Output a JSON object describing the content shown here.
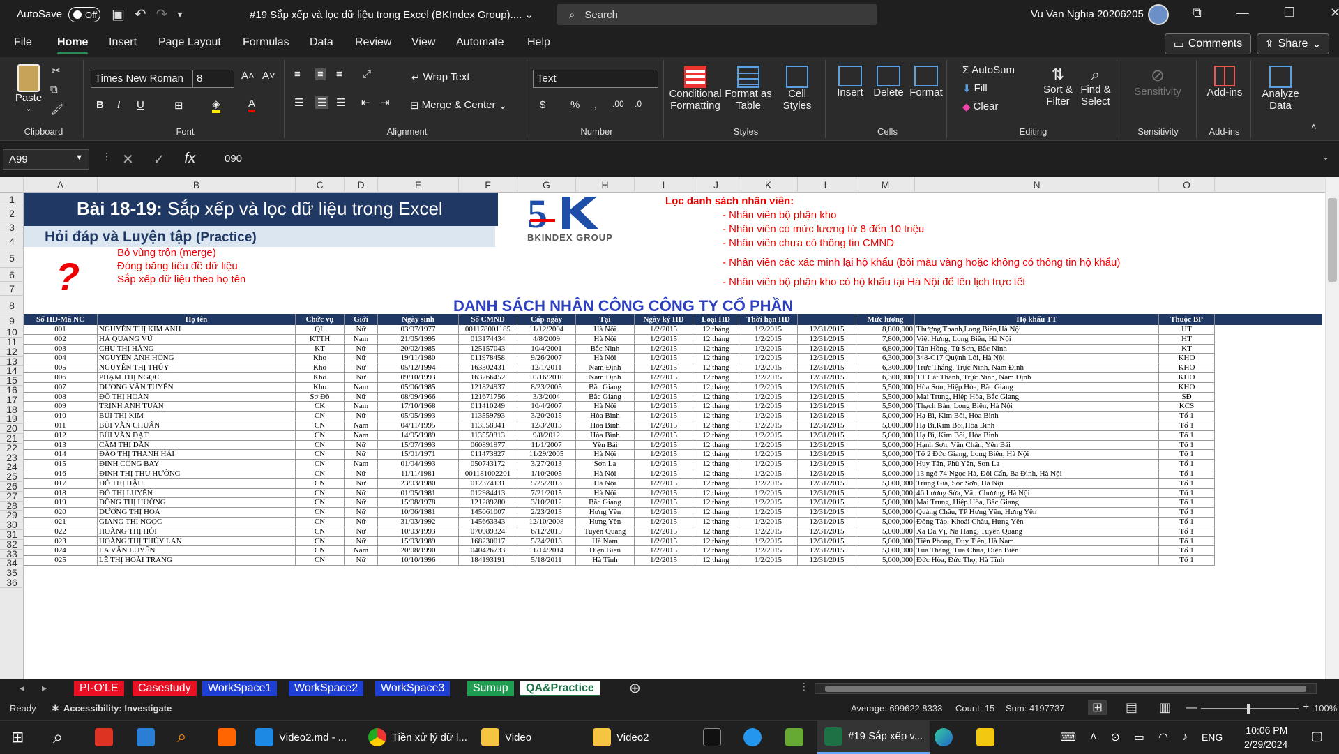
{
  "titlebar": {
    "autosave_label": "AutoSave",
    "autosave_state": "Off",
    "doc_title": "#19 Sắp xếp và lọc dữ liệu trong Excel (BKIndex Group)....",
    "search_placeholder": "Search",
    "user_name": "Vu Van Nghia 20206205"
  },
  "menu": {
    "tabs": [
      "File",
      "Home",
      "Insert",
      "Page Layout",
      "Formulas",
      "Data",
      "Review",
      "View",
      "Automate",
      "Help"
    ],
    "active": "Home",
    "comments": "Comments",
    "share": "Share"
  },
  "ribbon": {
    "clipboard": {
      "paste": "Paste",
      "label": "Clipboard"
    },
    "font": {
      "name": "Times New Roman",
      "size": "8",
      "label": "Font"
    },
    "alignment": {
      "wrap": "Wrap Text",
      "merge": "Merge & Center",
      "label": "Alignment"
    },
    "number": {
      "format": "Text",
      "label": "Number"
    },
    "styles": {
      "cond": "Conditional",
      "cond2": "Formatting",
      "fmt_table": "Format as",
      "fmt_table2": "Table",
      "cell_styles": "Cell",
      "cell_styles2": "Styles",
      "label": "Styles"
    },
    "cells": {
      "insert": "Insert",
      "delete": "Delete",
      "format": "Format",
      "label": "Cells"
    },
    "editing": {
      "autosum": "AutoSum",
      "fill": "Fill",
      "clear": "Clear",
      "sort": "Sort &",
      "sort2": "Filter",
      "find": "Find &",
      "find2": "Select",
      "label": "Editing"
    },
    "sensitivity": {
      "btn": "Sensitivity",
      "label": "Sensitivity"
    },
    "addins": {
      "btn": "Add-ins",
      "label": "Add-ins"
    },
    "analyze": {
      "btn": "Analyze",
      "btn2": "Data"
    }
  },
  "formula_bar": {
    "cell_ref": "A99",
    "value": "090"
  },
  "columns": [
    "A",
    "B",
    "C",
    "D",
    "E",
    "F",
    "G",
    "H",
    "I",
    "J",
    "K",
    "L",
    "M",
    "N",
    "O"
  ],
  "rows": [
    "1",
    "2",
    "3",
    "4",
    "5",
    "6",
    "7",
    "8",
    "9",
    "10",
    "11",
    "12",
    "13",
    "14",
    "15",
    "16",
    "17",
    "18",
    "19",
    "20",
    "21",
    "22",
    "23",
    "24",
    "25",
    "26",
    "27",
    "28",
    "29",
    "30",
    "31",
    "32",
    "33",
    "34",
    "35",
    "36"
  ],
  "content": {
    "banner_title_bold": "Bài 18-19:",
    "banner_title": " Sắp xếp và lọc dữ liệu trong Excel",
    "banner_sub": "Hỏi đáp và Luyện tập",
    "banner_sub2": "(Practice)",
    "logo_text": "BKINDEX GROUP",
    "qmark": "?",
    "tasks": [
      "Bỏ vùng trộn (merge)",
      "Đóng băng tiêu đề dữ liệu",
      "Sắp xếp dữ liệu theo họ tên"
    ],
    "filter_title": "Lọc danh sách nhân viên:",
    "filters": [
      "- Nhân viên bộ phận kho",
      "- Nhân viên có mức lương từ 8 đến 10 triệu",
      "- Nhân viên chưa có thông tin CMND",
      "- Nhân viên các xác minh lại hộ khẩu (bôi màu vàng hoặc không có thông tin hộ khẩu)",
      "- Nhân viên bộ phận kho có hộ khẩu tại Hà Nội để lên lịch trực tết"
    ],
    "list_title": "DANH SÁCH NHÂN CÔNG CÔNG TY CỔ PHẦN"
  },
  "table": {
    "headers": [
      "Số HĐ-Mã NC",
      "Họ tên",
      "Chức vụ",
      "Giới",
      "Ngày sinh",
      "Số CMND",
      "Cấp ngày",
      "Tại",
      "Ngày ký HĐ",
      "Loại HĐ",
      "Thời hạn HĐ",
      "",
      "Mức lương",
      "Hộ khẩu TT",
      "Thuộc BP"
    ],
    "rows": [
      [
        "001",
        "NGUYỄN THỊ KIM ANH",
        "QL",
        "Nữ",
        "03/07/1977",
        "001178001185",
        "11/12/2004",
        "Hà Nội",
        "1/2/2015",
        "12 tháng",
        "1/2/2015",
        "12/31/2015",
        "8,800,000",
        "Thượng Thanh,Long Biên,Hà Nội",
        "HT"
      ],
      [
        "002",
        "HÀ QUANG VŨ",
        "KTTH",
        "Nam",
        "21/05/1995",
        "013174434",
        "4/8/2009",
        "Hà Nội",
        "1/2/2015",
        "12 tháng",
        "1/2/2015",
        "12/31/2015",
        "7,800,000",
        "Việt Hưng, Long Biên, Hà Nội",
        "HT"
      ],
      [
        "003",
        "CHU THỊ HẰNG",
        "KT",
        "Nữ",
        "20/02/1985",
        "125157043",
        "10/4/2001",
        "Bắc Ninh",
        "1/2/2015",
        "12 tháng",
        "1/2/2015",
        "12/31/2015",
        "6,800,000",
        "Tân Hồng, Từ Sơn, Bắc Ninh",
        "KT"
      ],
      [
        "004",
        "NGUYỄN ÁNH HỒNG",
        "Kho",
        "Nữ",
        "19/11/1980",
        "011978458",
        "9/26/2007",
        "Hà Nội",
        "1/2/2015",
        "12 tháng",
        "1/2/2015",
        "12/31/2015",
        "6,300,000",
        "348-C17 Quỳnh Lôi, Hà Nội",
        "KHO"
      ],
      [
        "005",
        "NGUYỄN THỊ THÚY",
        "Kho",
        "Nữ",
        "05/12/1994",
        "163302431",
        "12/1/2011",
        "Nam Định",
        "1/2/2015",
        "12 tháng",
        "1/2/2015",
        "12/31/2015",
        "6,300,000",
        "Trực Thắng, Trực Ninh, Nam Định",
        "KHO"
      ],
      [
        "006",
        "PHẠM THỊ NGỌC",
        "Kho",
        "Nữ",
        "09/10/1993",
        "163266452",
        "10/16/2010",
        "Nam Định",
        "1/2/2015",
        "12 tháng",
        "1/2/2015",
        "12/31/2015",
        "6,300,000",
        "TT Cát Thành, Trực Ninh, Nam Định",
        "KHO"
      ],
      [
        "007",
        "DƯƠNG VĂN TUYẾN",
        "Kho",
        "Nam",
        "05/06/1985",
        "121824937",
        "8/23/2005",
        "Bắc Giang",
        "1/2/2015",
        "12 tháng",
        "1/2/2015",
        "12/31/2015",
        "5,500,000",
        "Hòa Sơn, Hiệp Hòa, Bắc Giang",
        "KHO"
      ],
      [
        "008",
        "ĐỖ THỊ HOÀN",
        "Sơ Đồ",
        "Nữ",
        "08/09/1966",
        "121671756",
        "3/3/2004",
        "Bắc Giang",
        "1/2/2015",
        "12 tháng",
        "1/2/2015",
        "12/31/2015",
        "5,500,000",
        "Mai Trung, Hiệp Hòa, Bắc Giang",
        "SĐ"
      ],
      [
        "009",
        "TRỊNH ANH TUẤN",
        "CK",
        "Nam",
        "17/10/1968",
        "011410249",
        "10/4/2007",
        "Hà Nội",
        "1/2/2015",
        "12 tháng",
        "1/2/2015",
        "12/31/2015",
        "5,500,000",
        "Thạch Bàn, Long Biên, Hà Nội",
        "KCS"
      ],
      [
        "010",
        "BÙI THỊ KIM",
        "CN",
        "Nữ",
        "05/05/1993",
        "113559793",
        "3/20/2015",
        "Hòa Bình",
        "1/2/2015",
        "12 tháng",
        "1/2/2015",
        "12/31/2015",
        "5,000,000",
        "Hạ Bì, Kim Bôi, Hòa Bình",
        "Tổ 1"
      ],
      [
        "011",
        "BÙI VĂN CHUẨN",
        "CN",
        "Nam",
        "04/11/1995",
        "113558941",
        "12/3/2013",
        "Hòa Bình",
        "1/2/2015",
        "12 tháng",
        "1/2/2015",
        "12/31/2015",
        "5,000,000",
        "Hạ Bì,Kim Bôi,Hòa Bình",
        "Tổ 1"
      ],
      [
        "012",
        "BÙI VĂN ĐẠT",
        "CN",
        "Nam",
        "14/05/1989",
        "113559813",
        "9/8/2012",
        "Hòa Bình",
        "1/2/2015",
        "12 tháng",
        "1/2/2015",
        "12/31/2015",
        "5,000,000",
        "Hạ Bì, Kim Bôi, Hòa Bình",
        "Tổ 1"
      ],
      [
        "013",
        "CẦM THỊ DẦN",
        "CN",
        "Nữ",
        "15/07/1993",
        "060891977",
        "11/1/2007",
        "Yên Bái",
        "1/2/2015",
        "12 tháng",
        "1/2/2015",
        "12/31/2015",
        "5,000,000",
        "Hạnh Sơn, Văn Chấn, Yên Bái",
        "Tổ 1"
      ],
      [
        "014",
        "ĐÀO THỊ THANH HẢI",
        "CN",
        "Nữ",
        "15/01/1971",
        "011473827",
        "11/29/2005",
        "Hà Nội",
        "1/2/2015",
        "12 tháng",
        "1/2/2015",
        "12/31/2015",
        "5,000,000",
        "Tổ 2 Đức Giang, Long Biên, Hà Nội",
        "Tổ 1"
      ],
      [
        "015",
        "ĐINH CÔNG BAY",
        "CN",
        "Nam",
        "01/04/1993",
        "050743172",
        "3/27/2013",
        "Sơn La",
        "1/2/2015",
        "12 tháng",
        "1/2/2015",
        "12/31/2015",
        "5,000,000",
        "Huy Tân, Phù Yên, Sơn La",
        "Tổ 1"
      ],
      [
        "016",
        "ĐINH THỊ THU HƯỜNG",
        "CN",
        "Nữ",
        "11/11/1981",
        "001181002201",
        "1/10/2005",
        "Hà Nội",
        "1/2/2015",
        "12 tháng",
        "1/2/2015",
        "12/31/2015",
        "5,000,000",
        "13 ngõ 74 Ngọc Hà, Đội Cấn, Ba Đình, Hà Nội",
        "Tổ 1"
      ],
      [
        "017",
        "ĐỖ THỊ HẬU",
        "CN",
        "Nữ",
        "23/03/1980",
        "012374131",
        "5/25/2013",
        "Hà Nội",
        "1/2/2015",
        "12 tháng",
        "1/2/2015",
        "12/31/2015",
        "5,000,000",
        "Trung Giã, Sóc Sơn, Hà Nội",
        "Tổ 1"
      ],
      [
        "018",
        "ĐỖ THỊ LUYẾN",
        "CN",
        "Nữ",
        "01/05/1981",
        "012984413",
        "7/21/2015",
        "Hà Nội",
        "1/2/2015",
        "12 tháng",
        "1/2/2015",
        "12/31/2015",
        "5,000,000",
        "46 Lương Sửa, Văn Chương, Hà Nội",
        "Tổ 1"
      ],
      [
        "019",
        "ĐỒNG THỊ HƯỜNG",
        "CN",
        "Nữ",
        "15/08/1978",
        "121289280",
        "3/10/2012",
        "Bắc Giang",
        "1/2/2015",
        "12 tháng",
        "1/2/2015",
        "12/31/2015",
        "5,000,000",
        "Mai Trung, Hiệp Hòa, Bắc Giang",
        "Tổ 1"
      ],
      [
        "020",
        "DƯƠNG THỊ HOA",
        "CN",
        "Nữ",
        "10/06/1981",
        "145061007",
        "2/23/2013",
        "Hưng Yên",
        "1/2/2015",
        "12 tháng",
        "1/2/2015",
        "12/31/2015",
        "5,000,000",
        "Quảng Châu, TP Hưng Yên, Hưng Yên",
        "Tổ 1"
      ],
      [
        "021",
        "GIANG THỊ NGỌC",
        "CN",
        "Nữ",
        "31/03/1992",
        "145663343",
        "12/10/2008",
        "Hưng Yên",
        "1/2/2015",
        "12 tháng",
        "1/2/2015",
        "12/31/2015",
        "5,000,000",
        "Đông Tảo, Khoái Châu, Hưng Yên",
        "Tổ 1"
      ],
      [
        "022",
        "HOÀNG THỊ HỎI",
        "CN",
        "Nữ",
        "10/03/1993",
        "070989324",
        "6/12/2015",
        "Tuyên Quang",
        "1/2/2015",
        "12 tháng",
        "1/2/2015",
        "12/31/2015",
        "5,000,000",
        "Xã Đà Vị, Na Hang, Tuyên Quang",
        "Tổ 1"
      ],
      [
        "023",
        "HOÀNG THỊ THÚY LAN",
        "CN",
        "Nữ",
        "15/03/1989",
        "168230017",
        "5/24/2013",
        "Hà Nam",
        "1/2/2015",
        "12 tháng",
        "1/2/2015",
        "12/31/2015",
        "5,000,000",
        "Tiên Phong, Duy Tiên, Hà Nam",
        "Tổ 1"
      ],
      [
        "024",
        "LA VĂN LUYẾN",
        "CN",
        "Nam",
        "20/08/1990",
        "040426733",
        "11/14/2014",
        "Điện Biên",
        "1/2/2015",
        "12 tháng",
        "1/2/2015",
        "12/31/2015",
        "5,000,000",
        "Tủa Thàng, Tủa Chùa, Điện Biên",
        "Tổ 1"
      ],
      [
        "025",
        "LÊ THỊ HOÀI TRANG",
        "CN",
        "Nữ",
        "10/10/1996",
        "184193191",
        "5/18/2011",
        "Hà Tĩnh",
        "1/2/2015",
        "12 tháng",
        "1/2/2015",
        "12/31/2015",
        "5,000,000",
        "Đức Hòa, Đức Thọ, Hà Tĩnh",
        "Tổ 1"
      ]
    ]
  },
  "sheet_tabs": [
    {
      "name": "PI-O'LE",
      "color": "#e81123"
    },
    {
      "name": "Casestudy",
      "color": "#e81123"
    },
    {
      "name": "WorkSpace1",
      "color": "#1e3fd6"
    },
    {
      "name": "WorkSpace2",
      "color": "#1e3fd6"
    },
    {
      "name": "WorkSpace3",
      "color": "#1e3fd6"
    },
    {
      "name": "Sumup",
      "color": "#1e9e50"
    },
    {
      "name": "QA&Practice",
      "color": "#ffffff"
    }
  ],
  "status": {
    "ready": "Ready",
    "accessibility": "Accessibility: Investigate",
    "average": "Average: 699622.8333",
    "count": "Count: 15",
    "sum": "Sum: 4197737",
    "zoom": "100%"
  },
  "taskbar": {
    "items": [
      "Video2.md - ...",
      "Tiền xử lý dữ l...",
      "Video",
      "Video2",
      "#19 Sắp xếp v..."
    ],
    "lang": "ENG",
    "time": "10:06 PM",
    "date": "2/29/2024"
  }
}
